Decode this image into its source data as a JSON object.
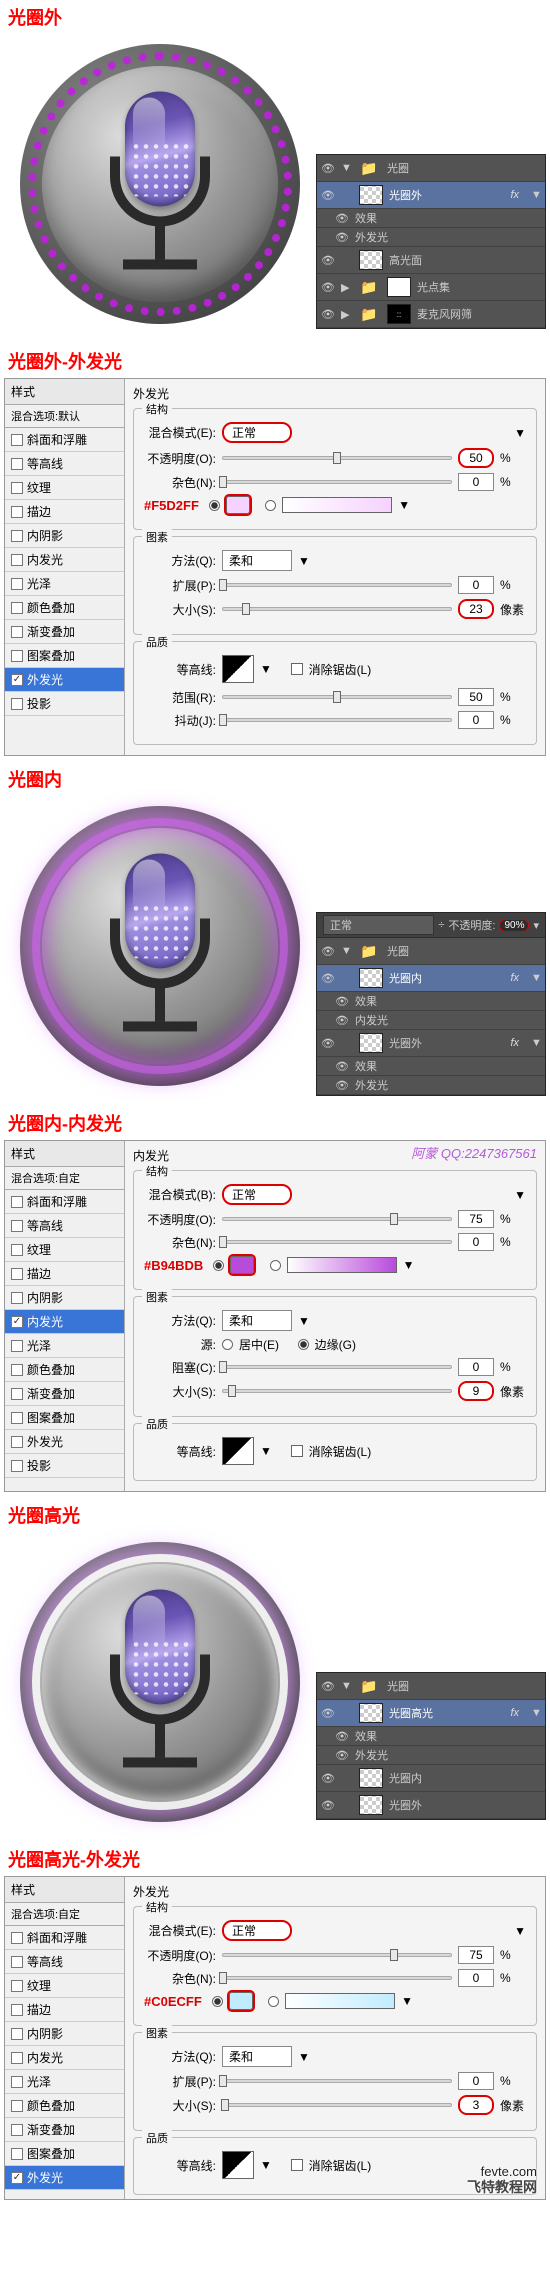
{
  "sections": {
    "s1": {
      "title": "光圈外"
    },
    "s2": {
      "title": "光圈外-外发光"
    },
    "s3": {
      "title": "光圈内"
    },
    "s4": {
      "title": "光圈内-内发光"
    },
    "s5": {
      "title": "光圈高光"
    },
    "s6": {
      "title": "光圈高光-外发光"
    }
  },
  "layers1": {
    "folder": "光圈",
    "items": [
      {
        "name": "光圈外",
        "fx": "fx",
        "sub1": "效果",
        "sub2": "外发光"
      },
      {
        "name": "高光面"
      },
      {
        "name": "光点集"
      },
      {
        "name": "麦克风网筛"
      }
    ]
  },
  "layers2": {
    "blendmode": "正常",
    "opacity_lbl": "不透明度:",
    "opacity_val": "90%",
    "folder": "光圈",
    "items": [
      {
        "name": "光圈内",
        "fx": "fx",
        "sub1": "效果",
        "sub2": "内发光"
      },
      {
        "name": "光圈外",
        "fx": "fx",
        "sub1": "效果",
        "sub2": "外发光"
      }
    ]
  },
  "layers3": {
    "folder": "光圈",
    "items": [
      {
        "name": "光圈高光",
        "fx": "fx",
        "sub1": "效果",
        "sub2": "外发光"
      },
      {
        "name": "光圈内"
      },
      {
        "name": "光圈外"
      }
    ]
  },
  "styleSidebar": {
    "head": "样式",
    "blend_default": "混合选项:默认",
    "blend_custom": "混合选项:自定",
    "items": {
      "bevel": "斜面和浮雕",
      "contour": "等高线",
      "texture": "纹理",
      "stroke": "描边",
      "innerShadow": "内阴影",
      "innerGlow": "内发光",
      "gloss": "光泽",
      "colorOverlay": "颜色叠加",
      "gradientOverlay": "渐变叠加",
      "patternOverlay": "图案叠加",
      "outerGlow": "外发光",
      "dropShadow": "投影"
    }
  },
  "labels": {
    "outerGlow": "外发光",
    "innerGlow": "内发光",
    "structure": "结构",
    "element": "图素",
    "quality": "品质",
    "blendMode": "混合模式(E):",
    "blendModeD": "混合模式(B):",
    "normal": "正常",
    "opacity": "不透明度(O):",
    "noise": "杂色(N):",
    "method": "方法(Q):",
    "soft": "柔和",
    "source": "源:",
    "center": "居中(E)",
    "edge": "边缘(G)",
    "spread": "扩展(P):",
    "choke": "阻塞(C):",
    "size": "大小(S):",
    "contourLbl": "等高线:",
    "antialias": "消除锯齿(L)",
    "range": "范围(R):",
    "jitter": "抖动(J):",
    "px": "像素",
    "pct": "%"
  },
  "panel1": {
    "hex": "#F5D2FF",
    "opacity": "50",
    "noise": "0",
    "spread": "0",
    "size": "23",
    "range": "50",
    "jitter": "0"
  },
  "panel2": {
    "hex": "#B94BDB",
    "opacity": "75",
    "noise": "0",
    "choke": "0",
    "size": "9",
    "signature_lbl": "阿蒙 QQ:",
    "signature_num": "2247367561"
  },
  "panel3": {
    "hex": "#C0ECFF",
    "opacity": "75",
    "noise": "0",
    "spread": "0",
    "size": "3"
  },
  "watermark": {
    "url": "fevte.com",
    "cn": "飞特教程网"
  }
}
